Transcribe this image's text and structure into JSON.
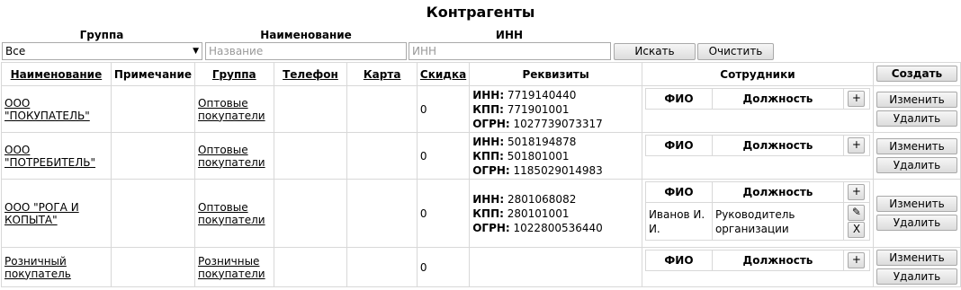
{
  "page_title": "Контрагенты",
  "filters": {
    "group_label": "Группа",
    "group_value": "Все",
    "name_label": "Наименование",
    "name_placeholder": "Название",
    "inn_label": "ИНН",
    "inn_placeholder": "ИНН",
    "search_button": "Искать",
    "clear_button": "Очистить"
  },
  "table": {
    "headers": {
      "name": "Наименование",
      "note": "Примечание",
      "group": "Группа",
      "phone": "Телефон",
      "card": "Карта",
      "discount": "Скидка",
      "requisites": "Реквизиты",
      "employees": "Сотрудники"
    },
    "create_button": "Создать",
    "employee_headers": {
      "fio": "ФИО",
      "position": "Должность"
    },
    "req_labels": {
      "inn": "ИНН:",
      "kpp": "КПП:",
      "ogrn": "ОГРН:"
    },
    "add_employee_symbol": "+",
    "edit_employee_symbol": "✎",
    "delete_employee_symbol": "X",
    "edit_button": "Изменить",
    "delete_button": "Удалить",
    "rows": [
      {
        "name": "ООО \"ПОКУПАТЕЛЬ\"",
        "note": "",
        "group": "Оптовые покупатели",
        "phone": "",
        "card": "",
        "discount": "0",
        "inn": "7719140440",
        "kpp": "771901001",
        "ogrn": "1027739073317",
        "employees": []
      },
      {
        "name": "ООО \"ПОТРЕБИТЕЛЬ\"",
        "note": "",
        "group": "Оптовые покупатели",
        "phone": "",
        "card": "",
        "discount": "0",
        "inn": "5018194878",
        "kpp": "501801001",
        "ogrn": "1185029014983",
        "employees": []
      },
      {
        "name": "ООО \"РОГА И КОПЫТА\"",
        "note": "",
        "group": "Оптовые покупатели",
        "phone": "",
        "card": "",
        "discount": "0",
        "inn": "2801068082",
        "kpp": "280101001",
        "ogrn": "1022800536440",
        "employees": [
          {
            "fio": "Иванов И. И.",
            "position": "Руководитель организации"
          }
        ]
      },
      {
        "name": "Розничный покупатель",
        "note": "",
        "group": "Розничные покупатели",
        "phone": "",
        "card": "",
        "discount": "0",
        "employees": []
      }
    ]
  }
}
